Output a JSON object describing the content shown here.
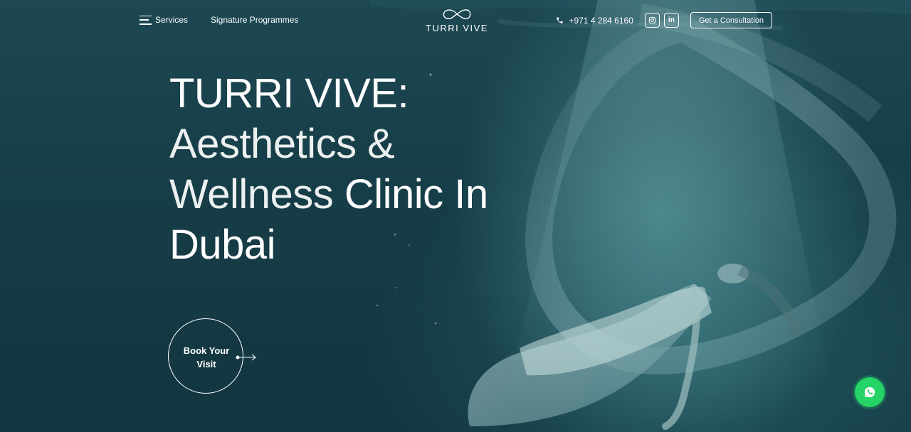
{
  "header": {
    "menu_icon": "hamburger-menu-icon",
    "services_label": "Services",
    "signature_label": "Signature Programmes",
    "logo_text": "TURRI VIVE",
    "phone_icon": "phone-icon",
    "phone_number": "+971 4 284 6160",
    "instagram_icon": "instagram-icon",
    "linkedin_label": "in",
    "consultation_label": "Get a Consultation"
  },
  "hero": {
    "title_line1": "TURRI VIVE:",
    "title_thin1": "Aesthetics &",
    "title_thin2": "Wellness",
    "title_bold2": "Clinic In",
    "title_bold3": "Dubai",
    "cta_line1": "Book Your",
    "cta_line2": "Visit"
  },
  "floating": {
    "whatsapp_icon": "whatsapp-icon"
  },
  "colors": {
    "background": "#173f49",
    "text": "#ffffff",
    "whatsapp": "#25d366"
  }
}
